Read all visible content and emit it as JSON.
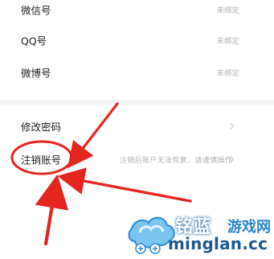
{
  "account_bindings": {
    "rows": [
      {
        "label": "微信号",
        "value": "未绑定"
      },
      {
        "label": "QQ号",
        "value": "未绑定"
      },
      {
        "label": "微博号",
        "value": "未绑定"
      }
    ]
  },
  "security": {
    "change_password": {
      "label": "修改密码",
      "icon": "chevron-right-icon"
    },
    "delete_account": {
      "label": "注销账号",
      "hint": "注销后账户无法恢复，请谨慎操作",
      "icon": "chevron-right-icon"
    }
  },
  "annotation": {
    "color": "#e52520",
    "style": "red circle with two pointing arrows"
  },
  "watermark": {
    "brand": "铭蓝",
    "suffix": "游戏网",
    "url": "minglan.cc"
  }
}
